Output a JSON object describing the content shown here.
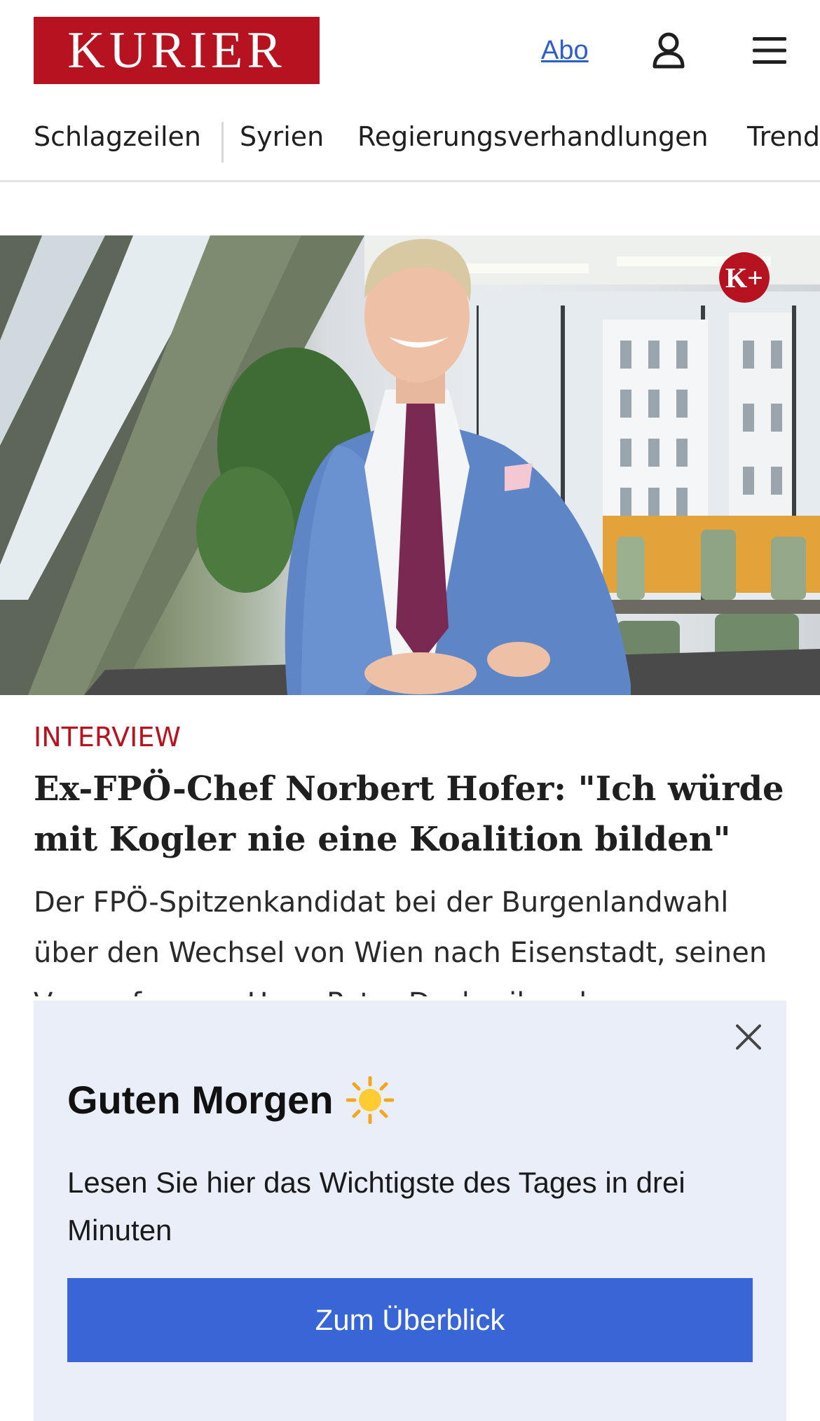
{
  "header": {
    "logo_text": "KURIER",
    "abo_label": "Abo",
    "user_icon": "user-icon",
    "menu_icon": "hamburger-menu-icon"
  },
  "nav": {
    "items": [
      "Schlagzeilen",
      "Syrien",
      "Regierungsverhandlungen",
      "Trend"
    ]
  },
  "article": {
    "badge_text": "K+",
    "kicker": "INTERVIEW",
    "headline": "Ex-FPÖ-Chef Norbert Hofer: \"Ich würde mit Kogler nie eine Koalition bilden\"",
    "teaser": "Der FPÖ-Spitzenkandidat bei der Burgenlandwahl über den Wechsel von Wien nach Eisenstadt, seinen Vorwurf gegen Hans Peter Doskozil und"
  },
  "popup": {
    "title": "Guten Morgen",
    "title_icon": "sun-icon",
    "text": "Lesen Sie hier das Wichtigste des Tages in drei Minuten",
    "button_label": "Zum Überblick",
    "close_icon": "close-icon"
  },
  "colors": {
    "brand_red": "#b7121f",
    "link_blue": "#2e5ec7",
    "button_blue": "#3966d6",
    "popup_bg": "#e9eef8"
  }
}
